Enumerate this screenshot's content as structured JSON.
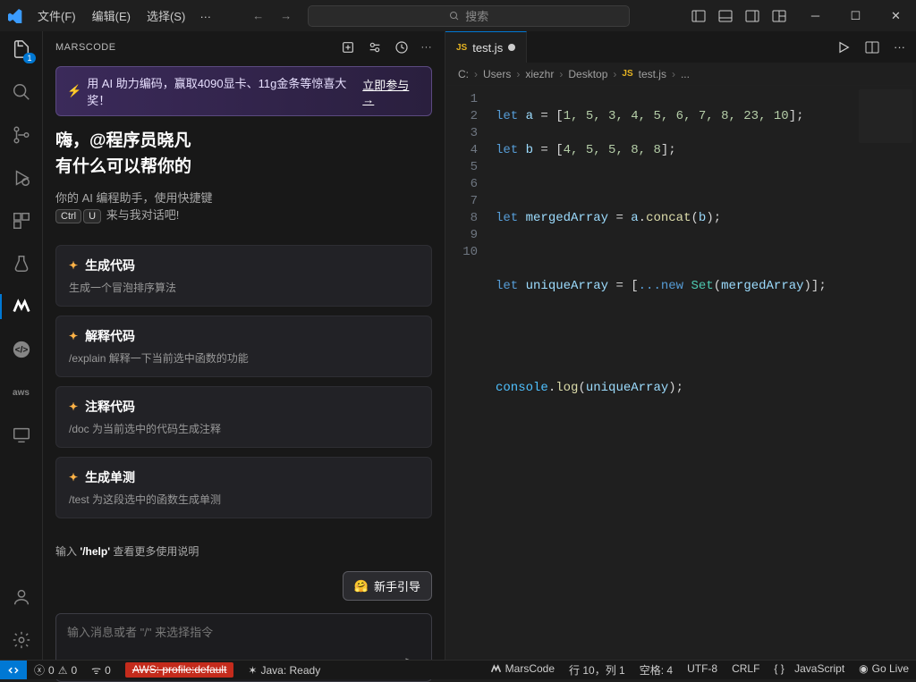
{
  "titlebar": {
    "menus": [
      "文件(F)",
      "编辑(E)",
      "选择(S)"
    ],
    "ellipsis": "…",
    "search_placeholder": "搜索"
  },
  "activity": {
    "explorer_badge": "1"
  },
  "panel": {
    "title": "MARSCODE",
    "banner_text": "用 AI 助力编码，赢取4090显卡、11g金条等惊喜大奖！",
    "banner_cta": "立即参与 →",
    "greeting_line1": "嗨，@程序员晓凡",
    "greeting_line2": "有什么可以帮你的",
    "sub_line": "你的 AI 编程助手，使用快捷键",
    "kbd1": "Ctrl",
    "kbd2": "U",
    "kbd_after": "来与我对话吧!",
    "cards": [
      {
        "title": "生成代码",
        "desc": "生成一个冒泡排序算法"
      },
      {
        "title": "解释代码",
        "desc": "/explain 解释一下当前选中函数的功能"
      },
      {
        "title": "注释代码",
        "desc": "/doc 为当前选中的代码生成注释"
      },
      {
        "title": "生成单测",
        "desc": "/test 为这段选中的函数生成单测"
      }
    ],
    "help_hint_pre": "输入 ",
    "help_hint_cmd": "'/help'",
    "help_hint_post": " 查看更多使用说明",
    "guide_btn": "新手引导",
    "chat_placeholder": "输入消息或者 \"/\" 来选择指令"
  },
  "editor": {
    "tab_name": "test.js",
    "breadcrumb": [
      "C:",
      "Users",
      "xiezhr",
      "Desktop",
      "test.js",
      "..."
    ],
    "lines": [
      "1",
      "2",
      "3",
      "4",
      "5",
      "6",
      "7",
      "8",
      "9",
      "10"
    ],
    "code": {
      "l1": {
        "let": "let",
        "a": "a",
        "eq": " = [",
        "nums": "1, 5, 3, 4, 5, 6, 7, 8, 23, 10",
        "end": "];"
      },
      "l2": {
        "let": "let",
        "b": "b",
        "eq": " = [",
        "nums": "4, 5, 5, 8, 8",
        "end": "];"
      },
      "l4": {
        "let": "let",
        "v": "mergedArray",
        "eq": " = ",
        "a": "a",
        "dot": ".",
        "fn": "concat",
        "open": "(",
        "b": "b",
        "close": ");"
      },
      "l6": {
        "let": "let",
        "v": "uniqueArray",
        "eq": " = [",
        "spread": "...",
        "new": "new ",
        "cls": "Set",
        "open": "(",
        "arg": "mergedArray",
        "close": ")];"
      },
      "l9": {
        "obj": "console",
        "dot": ".",
        "fn": "log",
        "open": "(",
        "arg": "uniqueArray",
        "close": ");"
      }
    }
  },
  "statusbar": {
    "errors": "0",
    "warnings": "0",
    "ports": "0",
    "aws": "AWS: profile:default",
    "java": "Java: Ready",
    "marscode": "MarsCode",
    "pos": "行 10，列 1",
    "spaces": "空格: 4",
    "encoding": "UTF-8",
    "eol": "CRLF",
    "lang": "JavaScript",
    "golive": "Go Live"
  }
}
